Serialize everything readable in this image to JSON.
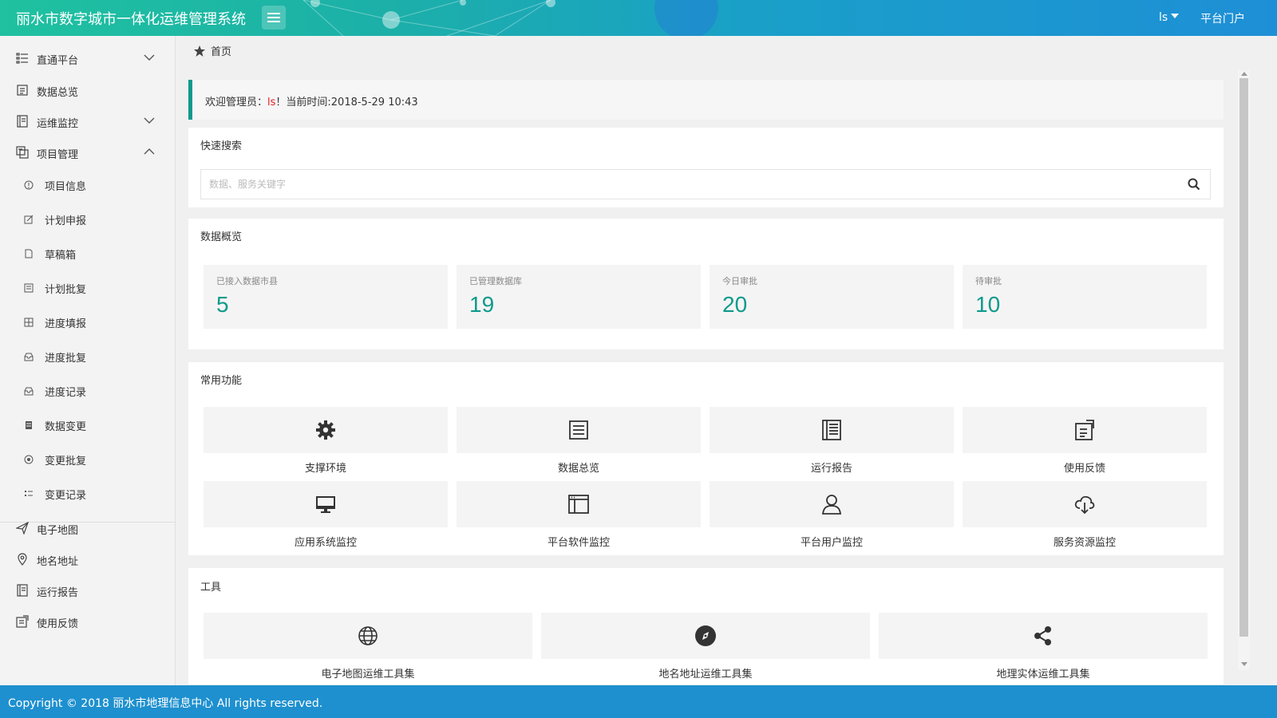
{
  "header": {
    "title": "丽水市数字城市一体化运维管理系统",
    "user": "ls",
    "portal": "平台门户",
    "colors": {
      "start": "#1fc1a0",
      "end": "#1e8fd6"
    }
  },
  "sidebar": {
    "items": [
      {
        "label": "直通平台",
        "icon": "list-icon",
        "expand": "chevron-down-icon"
      },
      {
        "label": "数据总览",
        "icon": "document-icon"
      },
      {
        "label": "运维监控",
        "icon": "book-icon",
        "expand": "chevron-down-icon"
      },
      {
        "label": "项目管理",
        "icon": "project-icon",
        "expand": "chevron-up-icon"
      }
    ],
    "subitems": [
      {
        "label": "项目信息",
        "icon": "info-icon"
      },
      {
        "label": "计划申报",
        "icon": "edit-icon"
      },
      {
        "label": "草稿箱",
        "icon": "file-icon"
      },
      {
        "label": "计划批复",
        "icon": "list-square-icon"
      },
      {
        "label": "进度填报",
        "icon": "grid-icon"
      },
      {
        "label": "进度批复",
        "icon": "inbox-icon"
      },
      {
        "label": "进度记录",
        "icon": "inbox-icon"
      },
      {
        "label": "数据变更",
        "icon": "database-icon"
      },
      {
        "label": "变更批复",
        "icon": "target-icon"
      },
      {
        "label": "变更记录",
        "icon": "list-icon"
      }
    ],
    "bottom": [
      {
        "label": "电子地图",
        "icon": "send-icon"
      },
      {
        "label": "地名地址",
        "icon": "map-pin-icon"
      },
      {
        "label": "运行报告",
        "icon": "book-icon"
      },
      {
        "label": "使用反馈",
        "icon": "feedback-icon"
      }
    ]
  },
  "breadcrumb": {
    "label": "首页"
  },
  "welcome": {
    "prefix": "欢迎管理员：",
    "name": "ls",
    "suffix": "！当前时间:2018-5-29 10:43"
  },
  "search": {
    "title": "快速搜索",
    "placeholder": "数据、服务关键字"
  },
  "overview": {
    "title": "数据概览",
    "stats": [
      {
        "label": "已接入数据市县",
        "value": "5"
      },
      {
        "label": "已管理数据库",
        "value": "19"
      },
      {
        "label": "今日审批",
        "value": "20"
      },
      {
        "label": "待审批",
        "value": "10"
      }
    ]
  },
  "functions": {
    "title": "常用功能",
    "items": [
      {
        "label": "支撑环境",
        "icon": "gear-icon"
      },
      {
        "label": "数据总览",
        "icon": "list-box-icon"
      },
      {
        "label": "运行报告",
        "icon": "newspaper-icon"
      },
      {
        "label": "使用反馈",
        "icon": "feedback-icon"
      },
      {
        "label": "应用系统监控",
        "icon": "monitor-icon"
      },
      {
        "label": "平台软件监控",
        "icon": "window-icon"
      },
      {
        "label": "平台用户监控",
        "icon": "user-icon"
      },
      {
        "label": "服务资源监控",
        "icon": "cloud-download-icon"
      }
    ]
  },
  "tools": {
    "title": "工具",
    "items": [
      {
        "label": "电子地图运维工具集",
        "icon": "globe-icon"
      },
      {
        "label": "地名地址运维工具集",
        "icon": "compass-icon"
      },
      {
        "label": "地理实体运维工具集",
        "icon": "share-icon"
      }
    ]
  },
  "footer": {
    "text": "Copyright © 2018 丽水市地理信息中心 All rights reserved."
  },
  "accent_color": "#0e9a8c"
}
